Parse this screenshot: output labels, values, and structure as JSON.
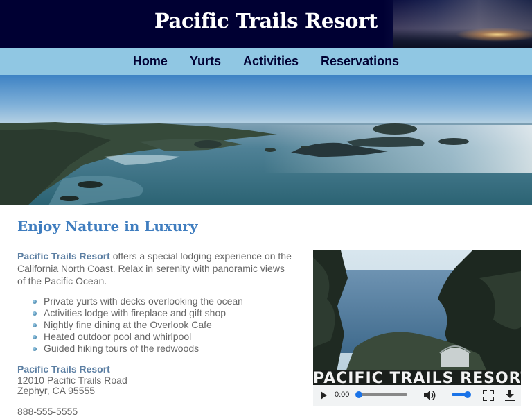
{
  "header": {
    "title": "Pacific Trails Resort"
  },
  "nav": {
    "items": [
      {
        "label": "Home"
      },
      {
        "label": "Yurts"
      },
      {
        "label": "Activities"
      },
      {
        "label": "Reservations"
      }
    ]
  },
  "main": {
    "heading": "Enjoy Nature in Luxury",
    "intro_name": "Pacific Trails Resort",
    "intro_text": " offers a special lodging experience on the California North Coast. Relax in serenity with panoramic views of the Pacific Ocean.",
    "features": [
      "Private yurts with decks overlooking the ocean",
      "Activities lodge with fireplace and gift shop",
      "Nightly fine dining at the Overlook Cafe",
      "Heated outdoor pool and whirlpool",
      "Guided hiking tours of the redwoods"
    ],
    "address": {
      "name": "Pacific Trails Resort",
      "street": "12010 Pacific Trails Road",
      "city": "Zephyr, CA 95555"
    },
    "phone": "888-555-5555"
  },
  "video": {
    "watermark": "PACIFIC TRAILS RESORT",
    "time": "0:00",
    "progress_fraction": 0.0,
    "volume_fraction": 1.0,
    "icons": [
      "play-icon",
      "volume-icon",
      "fullscreen-icon",
      "download-icon"
    ]
  },
  "colors": {
    "header_bg": "#000033",
    "nav_bg": "#90c7e3",
    "heading": "#3f7dbf",
    "accent_name": "#5c7fa3",
    "text": "#666666",
    "player_accent": "#1a73e8"
  }
}
